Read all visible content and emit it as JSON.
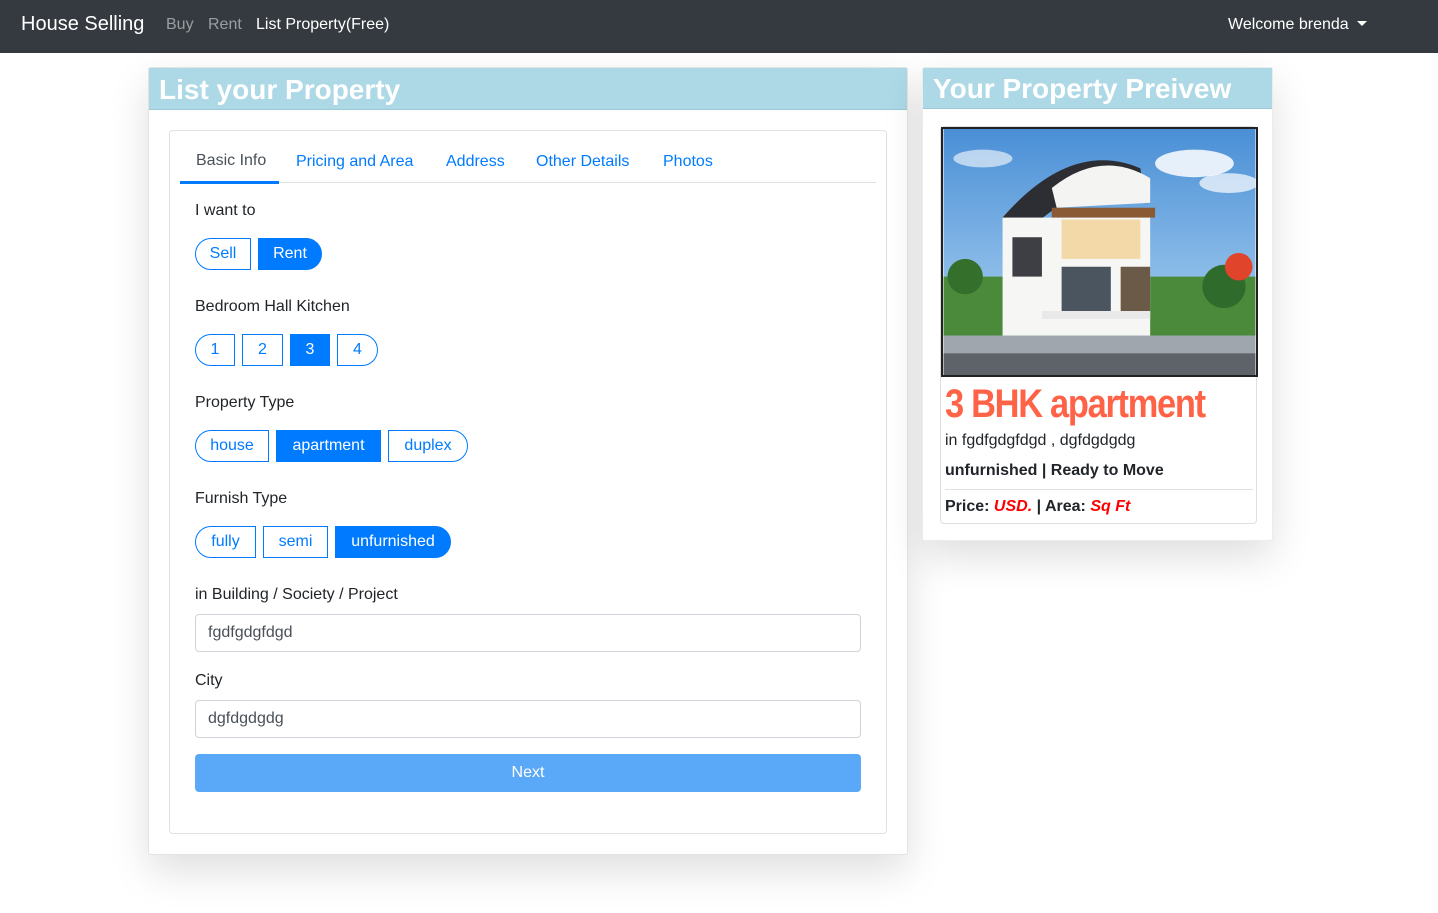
{
  "navbar": {
    "brand": "House Selling",
    "links": [
      "Buy",
      "Rent",
      "List Property(Free)"
    ],
    "user": "Welcome brenda"
  },
  "form_card": {
    "title": "List your Property",
    "tabs": [
      "Basic Info",
      "Pricing and Area",
      "Address",
      "Other Details",
      "Photos"
    ],
    "active_tab": "Basic Info",
    "want_to": {
      "label": "I want to",
      "options": [
        "Sell",
        "Rent"
      ],
      "selected": "Rent"
    },
    "bhk": {
      "label": "Bedroom Hall Kitchen",
      "options": [
        "1",
        "2",
        "3",
        "4"
      ],
      "selected": "3"
    },
    "property_type": {
      "label": "Property Type",
      "options": [
        "house",
        "apartment",
        "duplex"
      ],
      "selected": "apartment"
    },
    "furnish_type": {
      "label": "Furnish Type",
      "options": [
        "fully",
        "semi",
        "unfurnished"
      ],
      "selected": "unfurnished"
    },
    "building": {
      "label": "in Building / Society / Project",
      "value": "fgdfgdgfdgd"
    },
    "city": {
      "label": "City",
      "value": "dgfdgdgdg"
    },
    "next_label": "Next"
  },
  "preview": {
    "title": "Your Property Preivew",
    "image_icon": "house-photo",
    "heading": "3 BHK apartment",
    "location": "in fgdfgdgfdgd , dgfdgdgdg",
    "status": "unfurnished | Ready to Move",
    "price_label": "Price:",
    "price_value": "USD.",
    "sep": "|",
    "area_label": "Area:",
    "area_value": "Sq Ft"
  },
  "colors": {
    "navbar": "#343a40",
    "primary": "#007bff",
    "header_band": "#add8e6",
    "heading_red": "#ff6347",
    "next_button": "#5aa9f9"
  }
}
